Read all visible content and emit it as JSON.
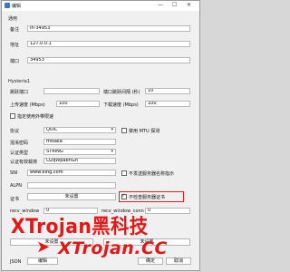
{
  "window": {
    "title": "编辑",
    "minimize_glyph": "—",
    "maximize_glyph": "☐",
    "close_glyph": "✕"
  },
  "general": {
    "group_label": "通用",
    "remark_label": "备注",
    "remark_value": "in-34953",
    "address_label": "地址",
    "address_value": "127.0.0.1",
    "port_label": "端口",
    "port_value": "34953"
  },
  "hysteria": {
    "group_label": "Hysteria1",
    "hop_port_label": "跳跃端口",
    "hop_port_value": "",
    "hop_interval_label": "端口跳跃间隔 (秒)",
    "hop_interval_value": "10",
    "up_label": "上传速度 (Mbps)",
    "up_value": "100",
    "down_label": "下载速度 (Mbps)",
    "down_value": "100",
    "specify_bandwidth_label": "指定使用外带限速",
    "protocol_label": "协议",
    "protocol_value": "QUIC",
    "disable_mtu_label": "禁用 MTU 探测",
    "obfs_label": "混淆密码",
    "obfs_value": "misaka",
    "auth_type_label": "认证类型",
    "auth_type_value": "STRING",
    "auth_payload_label": "认证有效载荷",
    "auth_payload_value": "O2qWpabnGn",
    "sni_label": "SNI",
    "sni_value": "www.bing.com",
    "no_sni_label": "不发送服务器名称指示",
    "alpn_label": "ALPN",
    "alpn_value": "",
    "cert_label": "证书",
    "cert_button": "未设置",
    "skip_verify_label": "不检查服务器证书",
    "recv_window_label": "recv_window",
    "recv_window_value": "0",
    "recv_window_conn_label": "recv_window_conn",
    "recv_window_conn_value": "0",
    "setting_btn_1": "未设置",
    "setting_btn_2": "未设置"
  },
  "footer": {
    "json_label": "JSON",
    "edit_button": "编辑",
    "ok_button": "确定",
    "cancel_button": "取消"
  },
  "watermark": {
    "line1": "XTrojan黑科技",
    "line2": "XTrojan.CC"
  },
  "colors": {
    "accent": "#e01818",
    "window_bg": "#f0f0f0"
  }
}
